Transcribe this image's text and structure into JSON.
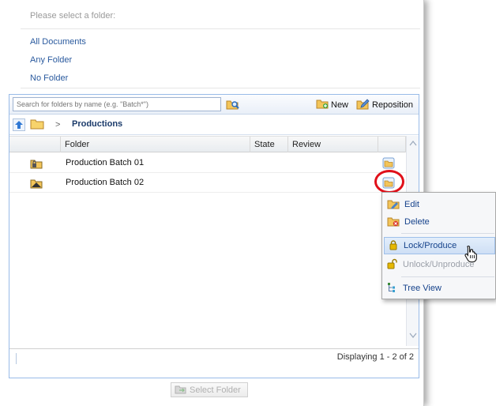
{
  "dialog": {
    "prompt": "Please select a folder:",
    "quick_links": [
      "All Documents",
      "Any Folder",
      "No Folder"
    ]
  },
  "toolbar": {
    "search_placeholder": "Search for folders by name (e.g. \"Batch*\")",
    "new_label": "New",
    "reposition_label": "Reposition"
  },
  "breadcrumb": {
    "separator": ">",
    "current": "Productions"
  },
  "table": {
    "columns": [
      "Folder",
      "State",
      "Review"
    ],
    "rows": [
      {
        "name": "Production Batch 01",
        "icon": "locked-folder-icon"
      },
      {
        "name": "Production Batch 02",
        "icon": "produce-folder-icon"
      }
    ]
  },
  "paging": {
    "text": "Displaying 1 - 2 of 2"
  },
  "footer": {
    "select_label": "Select Folder"
  },
  "context_menu": {
    "items": [
      {
        "label": "Edit",
        "icon": "edit-folder-icon",
        "state": "normal"
      },
      {
        "label": "Delete",
        "icon": "delete-folder-icon",
        "state": "normal"
      },
      {
        "label": "Lock/Produce",
        "icon": "lock-icon",
        "state": "hover"
      },
      {
        "label": "Unlock/Unproduce",
        "icon": "unlock-icon",
        "state": "disabled"
      },
      {
        "label": "Tree View",
        "icon": "tree-view-icon",
        "state": "normal"
      }
    ]
  },
  "colors": {
    "link": "#2a5a9e",
    "menu_text": "#15428b",
    "highlight": "#e0101a",
    "grid_border": "#99bbe8"
  }
}
